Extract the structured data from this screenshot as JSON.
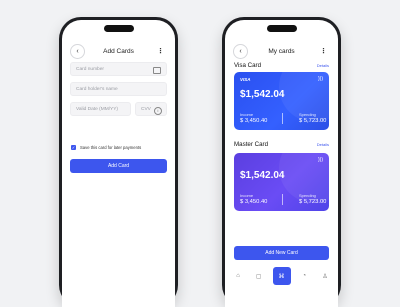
{
  "add_screen": {
    "title": "Add Cards",
    "back_icon": "chevron-left-icon",
    "more_icon": "more-vertical-icon",
    "fields": {
      "card_number": "Card number",
      "holder_name": "Card holder's name",
      "valid_date": "Valid Date (MM/YY)",
      "cvv": "CVV"
    },
    "save_card_label": "Save this card for later payments",
    "save_card_checked": true,
    "add_button": "Add Card"
  },
  "cards_screen": {
    "title": "My cards",
    "visa": {
      "section": "Visa Card",
      "details": "Details",
      "brand": "VISA",
      "balance": "$1,542.04",
      "income_label": "Income",
      "income_value": "$ 3,450.40",
      "spending_label": "Spending",
      "spending_value": "$ 5,723.00"
    },
    "master": {
      "section": "Master Card",
      "details": "Details",
      "balance": "$1,542.04",
      "income_label": "Income",
      "income_value": "$ 3,450.40",
      "spending_label": "Spending",
      "spending_value": "$ 5,723.00"
    },
    "add_new_button": "Add New Card",
    "nav_icons": [
      "home-icon",
      "wallet-icon",
      "cards-icon",
      "stats-icon",
      "profile-icon"
    ],
    "active_nav_index": 2
  },
  "colors": {
    "accent": "#3d56ee",
    "visa_card": "#2a50f0",
    "master_card": "#5b3fe0",
    "background": "#f1f2f4"
  }
}
